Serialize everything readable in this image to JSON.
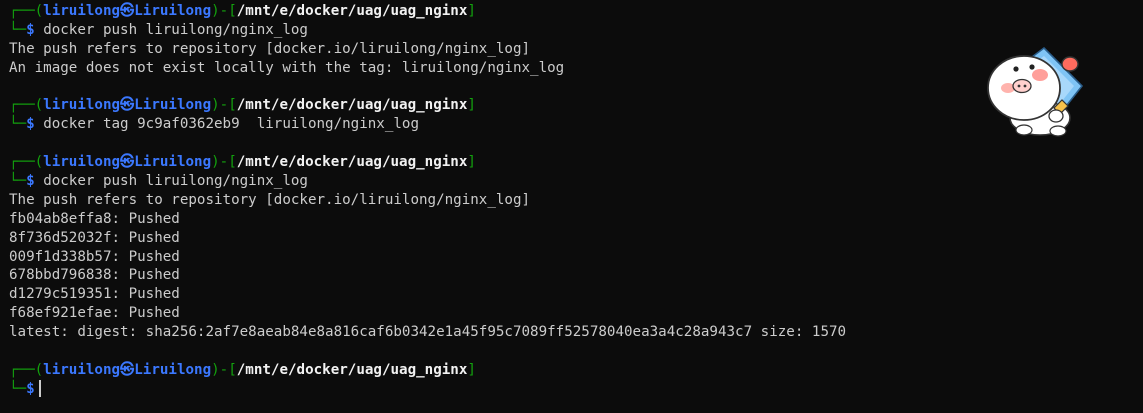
{
  "prompt": {
    "corner_top": "┌──",
    "corner_bottom": "└─",
    "open_paren": "(",
    "user": "liruilong",
    "separator": "㉿",
    "host": "Liruilong",
    "close_paren_dash": ")-[",
    "path": "/mnt/e/docker/uag/uag_nginx",
    "close_bracket": "]",
    "dollar": "$"
  },
  "blocks": [
    {
      "command": "docker push liruilong/nginx_log",
      "output": [
        "The push refers to repository [docker.io/liruilong/nginx_log]",
        "An image does not exist locally with the tag: liruilong/nginx_log"
      ]
    },
    {
      "command": "docker tag 9c9af0362eb9  liruilong/nginx_log",
      "output": []
    },
    {
      "command": "docker push liruilong/nginx_log",
      "output": [
        "The push refers to repository [docker.io/liruilong/nginx_log]",
        "fb04ab8effa8: Pushed",
        "8f736d52032f: Pushed",
        "009f1d338b57: Pushed",
        "678bbd796838: Pushed",
        "d1279c519351: Pushed",
        "f68ef921efae: Pushed",
        "latest: digest: sha256:2af7e8aeab84e8a816caf6b0342e1a45f95c7089ff52578040ea3a4c28a943c7 size: 1570"
      ]
    },
    {
      "command": "",
      "output": []
    }
  ],
  "colors": {
    "background": "#0c0c0c",
    "prompt_green": "#13a10e",
    "prompt_blue": "#3b78ff",
    "text": "#cccccc"
  },
  "icons": {
    "sticker": "cartoon-pig-mascot-sticker"
  }
}
